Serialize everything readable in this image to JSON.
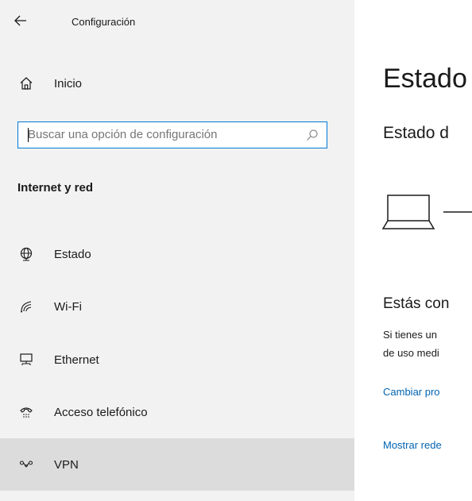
{
  "window": {
    "title": "Configuración"
  },
  "sidebar": {
    "home_label": "Inicio",
    "search": {
      "placeholder": "Buscar una opción de configuración"
    },
    "section_title": "Internet y red",
    "items": [
      {
        "label": "Estado",
        "icon": "globe-icon"
      },
      {
        "label": "Wi-Fi",
        "icon": "wifi-icon"
      },
      {
        "label": "Ethernet",
        "icon": "ethernet-icon"
      },
      {
        "label": "Acceso telefónico",
        "icon": "dialup-icon"
      },
      {
        "label": "VPN",
        "icon": "vpn-icon",
        "selected": true
      }
    ]
  },
  "main": {
    "title": "Estado",
    "subtitle": "Estado d",
    "connection_text": "Estás con",
    "body_lines": [
      "Si tienes un",
      "de uso medi"
    ],
    "links": [
      "Cambiar pro",
      "Mostrar rede"
    ]
  },
  "colors": {
    "accent": "#0078d7",
    "link": "#0063b1",
    "sidebar_bg": "#f2f2f2",
    "selected_bg": "#dcdcdc"
  }
}
